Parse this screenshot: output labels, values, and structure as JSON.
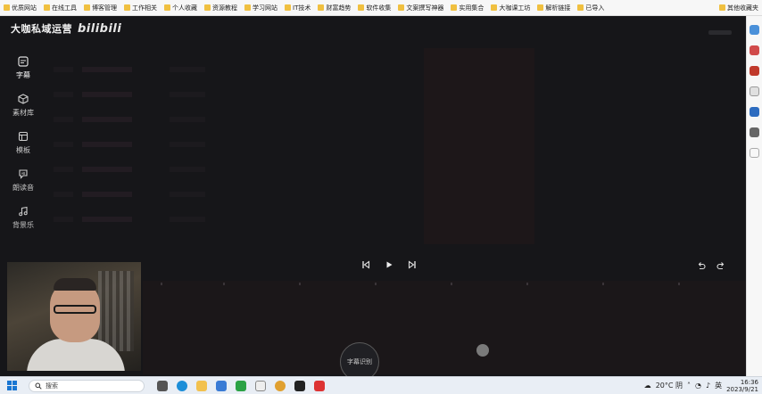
{
  "bookmarks": [
    {
      "label": "优质网站",
      "icon": "folder-icon"
    },
    {
      "label": "在线工具",
      "icon": "folder-icon"
    },
    {
      "label": "博客管理",
      "icon": "folder-icon"
    },
    {
      "label": "工作相关",
      "icon": "folder-icon"
    },
    {
      "label": "个人收藏",
      "icon": "folder-icon"
    },
    {
      "label": "资源教程",
      "icon": "folder-icon"
    },
    {
      "label": "学习网站",
      "icon": "folder-icon"
    },
    {
      "label": "IT技术",
      "icon": "folder-icon"
    },
    {
      "label": "财富趋势",
      "icon": "folder-icon"
    },
    {
      "label": "软件收集",
      "icon": "folder-icon"
    },
    {
      "label": "文案撰写神器",
      "icon": "folder-icon"
    },
    {
      "label": "实用集合",
      "icon": "folder-icon"
    },
    {
      "label": "大咖课工坊",
      "icon": "folder-icon"
    },
    {
      "label": "解析链接",
      "icon": "folder-icon"
    },
    {
      "label": "已导入",
      "icon": "folder-icon"
    }
  ],
  "bookmarks_other": "其他收藏夹",
  "app": {
    "title": "大咖私域运营",
    "brand": "bilibili",
    "sidebar": [
      {
        "label": "字幕",
        "icon": "subtitle-icon",
        "active": true
      },
      {
        "label": "素材库",
        "icon": "cube-icon",
        "active": false
      },
      {
        "label": "模板",
        "icon": "template-icon",
        "active": false
      },
      {
        "label": "朗读音",
        "icon": "voice-icon",
        "active": false
      },
      {
        "label": "背景乐",
        "icon": "music-icon",
        "active": false
      }
    ],
    "subtitle_button": "字幕识别"
  },
  "taskbar": {
    "search_placeholder": "搜索",
    "weather": "20°C 阴",
    "ime": "英",
    "time": "16:36",
    "date": "2023/9/21"
  }
}
